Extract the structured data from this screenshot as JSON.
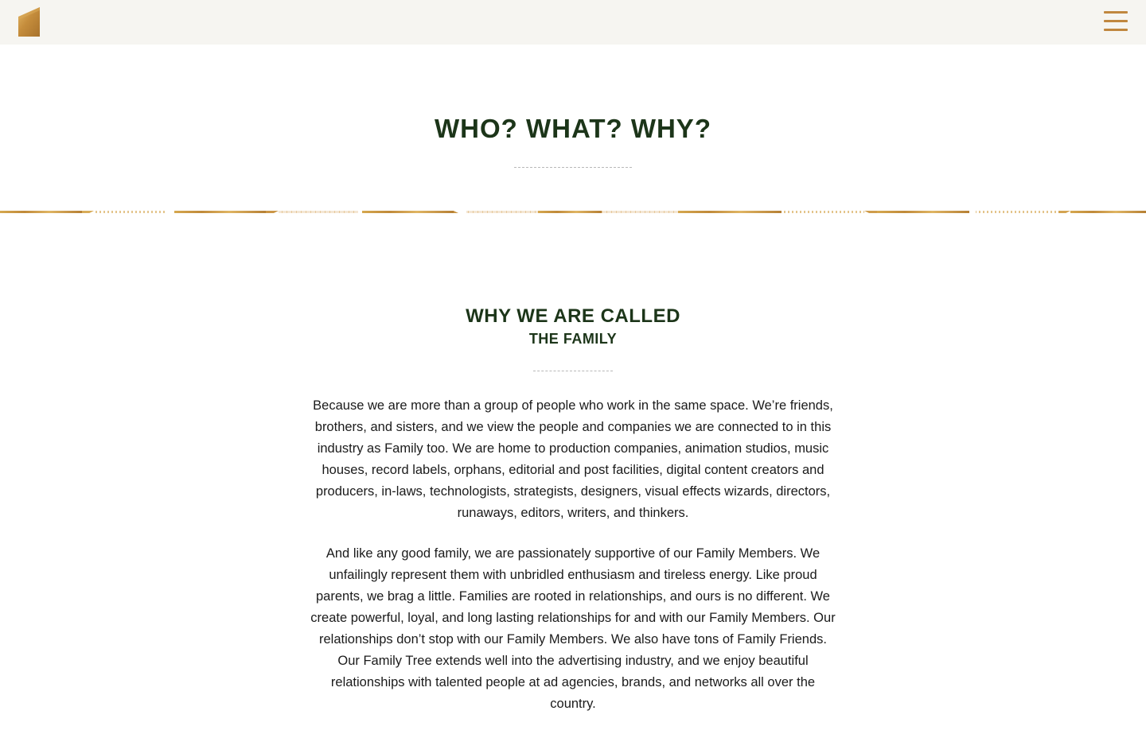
{
  "header": {
    "logo_icon": "building-logo-icon",
    "menu_icon": "hamburger-menu-icon",
    "accent_color": "#c0873f",
    "background_color": "#f6f5f1"
  },
  "hero": {
    "title": "WHO? WHAT? WHY?",
    "title_color": "#1c3519"
  },
  "section": {
    "title_line1": "WHY WE ARE CALLED",
    "title_line2": "THE FAMILY",
    "paragraphs": [
      "Because we are more than a group of people who work in the same space. We’re friends, brothers, and sisters, and we view the people and companies we are connected to in this industry as Family too. We are home to production companies, animation studios, music houses, record labels, orphans, editorial and post facilities, digital content creators and producers, in-laws, technologists, strategists, designers, visual effects wizards, directors, runaways, editors, writers, and thinkers.",
      "And like any good family, we are passionately supportive of our Family Members. We unfailingly represent them with unbridled enthusiasm and tireless energy. Like proud parents, we brag a little.  Families are rooted in relationships, and ours is no different. We create powerful, loyal, and long lasting relationships for and with our Family Members. Our relationships don’t stop with our Family Members. We also have tons of Family Friends.  Our Family Tree extends well into the advertising industry, and we enjoy beautiful relationships with talented people at ad agencies, brands, and networks all over the country."
    ]
  }
}
